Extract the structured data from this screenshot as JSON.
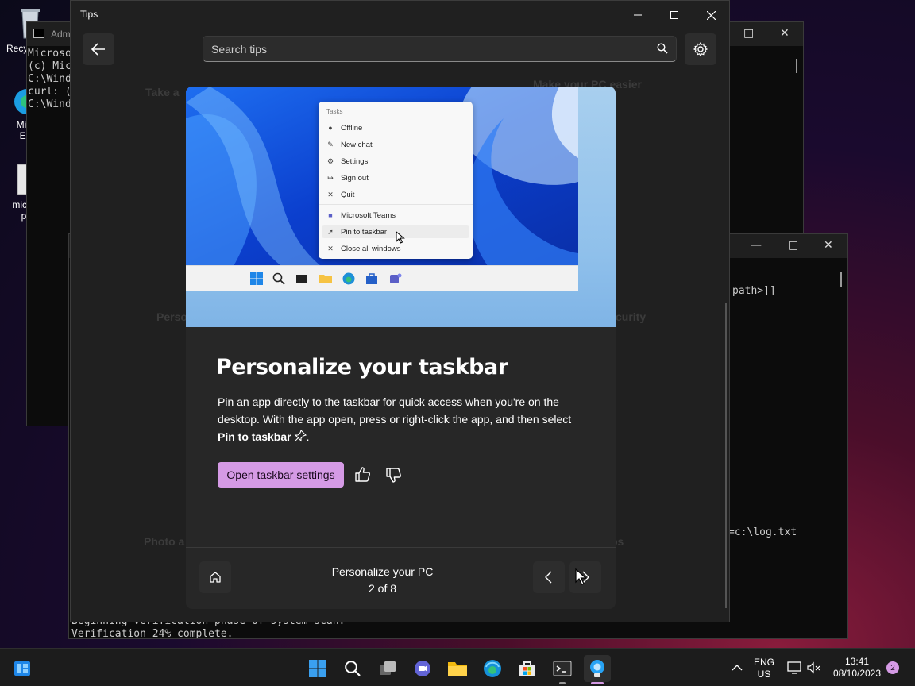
{
  "desktop": {
    "icons": [
      {
        "label": "Recy"
      },
      {
        "label": "Micr\nEd"
      },
      {
        "label": "micro\np"
      }
    ]
  },
  "terminal_bg1": {
    "title": "Adm",
    "lines": [
      "Microso",
      "(c) Mic",
      "",
      "C:\\Wind",
      "curl: (",
      "",
      "C:\\Wind"
    ]
  },
  "terminal_bg2": {
    "lines_right": [
      "path>]]",
      "=c:\\log.txt"
    ],
    "bottom_lines": [
      "Beginning verification phase of system scan.",
      "Verification 24% complete."
    ]
  },
  "tips_window": {
    "title": "Tips",
    "search": {
      "placeholder": "Search tips"
    },
    "background_categories": [
      "Take a",
      "Make your PC easier",
      "Perso",
      "curity",
      "Photo a",
      "ps"
    ],
    "card": {
      "screenshot_menu": {
        "title": "Tasks",
        "items": [
          "Offline",
          "New chat",
          "Settings",
          "Sign out",
          "Quit",
          "Microsoft Teams",
          "Pin to taskbar",
          "Close all windows"
        ]
      },
      "title": "Personalize your taskbar",
      "body_text": "Pin an app directly to the taskbar for quick access when you're on the desktop. With the app open, press or right-click the app, and then select ",
      "body_bold": "Pin to taskbar",
      "body_end": ".",
      "primary_button": "Open taskbar settings",
      "collection_title": "Personalize your PC",
      "position": "2 of 8"
    }
  },
  "taskbar": {
    "language": "ENG",
    "region": "US",
    "time": "13:41",
    "date": "08/10/2023",
    "notification_count": "2"
  },
  "colors": {
    "accent": "#d59ae5",
    "window_bg": "#202020",
    "card_bg": "#272727"
  }
}
